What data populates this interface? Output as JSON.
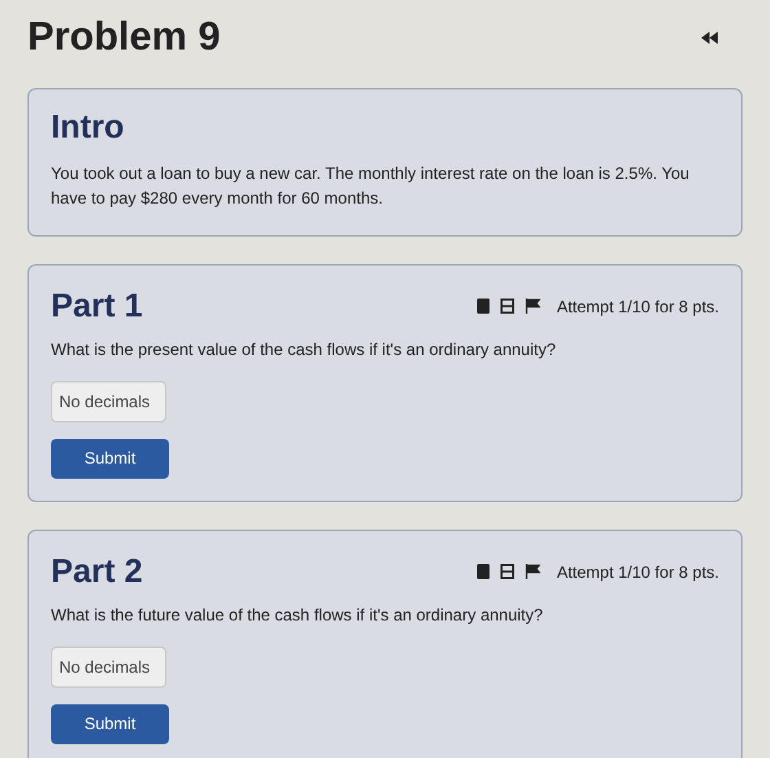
{
  "title": "Problem 9",
  "intro": {
    "heading": "Intro",
    "text": "You took out a loan to buy a new car. The monthly interest rate on the loan is 2.5%. You have to pay $280 every month for 60 months."
  },
  "parts": [
    {
      "heading": "Part 1",
      "attempt": "Attempt 1/10 for 8 pts.",
      "question": "What is the present value of the cash flows if it's an ordinary annuity?",
      "placeholder": "No decimals",
      "button": "Submit"
    },
    {
      "heading": "Part 2",
      "attempt": "Attempt 1/10 for 8 pts.",
      "question": "What is the future value of the cash flows if it's an ordinary annuity?",
      "placeholder": "No decimals",
      "button": "Submit"
    }
  ]
}
